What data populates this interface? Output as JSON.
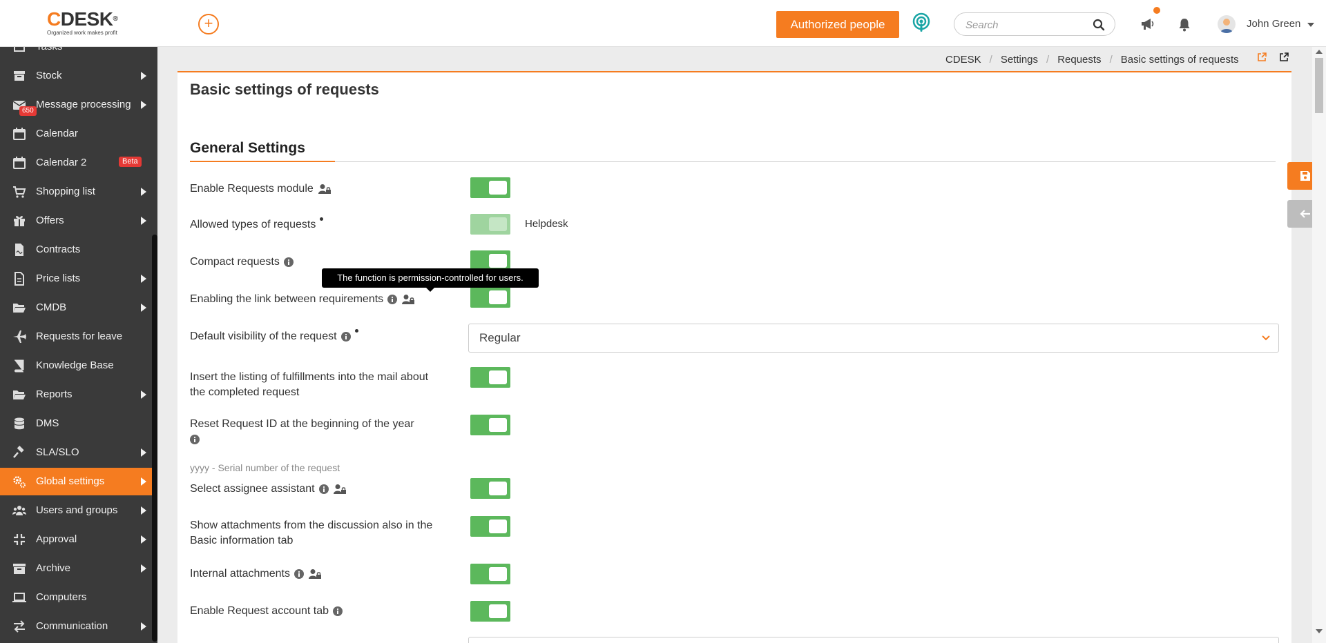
{
  "header": {
    "logo_text": "DESK",
    "logo_c": "C",
    "logo_reg": "®",
    "logo_tagline": "Organized work makes profit",
    "add_label": "+",
    "authorized_label": "Authorized people",
    "search_placeholder": "Search",
    "user_name": "John Green"
  },
  "sidebar": {
    "items": [
      {
        "label": "Tasks",
        "icon": "tasks-icon",
        "arrow": false
      },
      {
        "label": "Stock",
        "icon": "stock-icon",
        "arrow": true
      },
      {
        "label": "Message processing",
        "icon": "mail-icon",
        "arrow": true,
        "badge": "650"
      },
      {
        "label": "Calendar",
        "icon": "calendar-icon",
        "arrow": false
      },
      {
        "label": "Calendar 2",
        "icon": "calendar-icon",
        "arrow": false,
        "beta": "Beta"
      },
      {
        "label": "Shopping list",
        "icon": "cart-icon",
        "arrow": true
      },
      {
        "label": "Offers",
        "icon": "gift-icon",
        "arrow": true
      },
      {
        "label": "Contracts",
        "icon": "contract-icon",
        "arrow": false
      },
      {
        "label": "Price lists",
        "icon": "document-icon",
        "arrow": true
      },
      {
        "label": "CMDB",
        "icon": "folder-open-icon",
        "arrow": true
      },
      {
        "label": "Requests for leave",
        "icon": "plane-icon",
        "arrow": false
      },
      {
        "label": "Knowledge Base",
        "icon": "book-icon",
        "arrow": false
      },
      {
        "label": "Reports",
        "icon": "folder-open-icon",
        "arrow": true
      },
      {
        "label": "DMS",
        "icon": "database-icon",
        "arrow": false
      },
      {
        "label": "SLA/SLO",
        "icon": "gavel-icon",
        "arrow": true
      },
      {
        "label": "Global settings",
        "icon": "cogs-icon",
        "arrow": true,
        "active": true
      },
      {
        "label": "Users and groups",
        "icon": "users-icon",
        "arrow": true
      },
      {
        "label": "Approval",
        "icon": "compress-icon",
        "arrow": true
      },
      {
        "label": "Archive",
        "icon": "archive-icon",
        "arrow": true
      },
      {
        "label": "Computers",
        "icon": "laptop-icon",
        "arrow": false
      },
      {
        "label": "Communication",
        "icon": "exchange-icon",
        "arrow": true
      }
    ]
  },
  "breadcrumb": [
    "CDESK",
    "Settings",
    "Requests",
    "Basic settings of requests"
  ],
  "breadcrumb_sep": "/",
  "page_title": "Basic settings of requests",
  "section_title": "General Settings",
  "settings": {
    "enable_requests": "Enable Requests module",
    "allowed_types": "Allowed types of requests",
    "allowed_types_value": "Helpdesk",
    "compact": "Compact requests",
    "enabling_link": "Enabling the link between requirements",
    "default_visibility": "Default visibility of the request",
    "default_visibility_value": "Regular",
    "insert_listing": "Insert the listing of fulfillments into the mail about the completed request",
    "reset_id": "Reset Request ID at the beginning of the year",
    "reset_id_hint": "yyyy - Serial number of the request",
    "select_assistant": "Select assignee assistant",
    "show_attachments": "Show attachments from the discussion also in the Basic information tab",
    "internal_attachments": "Internal attachments",
    "enable_account_tab": "Enable Request account tab"
  },
  "tooltip": "The function is permission-controlled for users.",
  "colors": {
    "accent": "#f57c20",
    "toggle_on": "#5cb85c",
    "sidebar_bg": "#3a3a3a",
    "badge": "#e53935"
  }
}
